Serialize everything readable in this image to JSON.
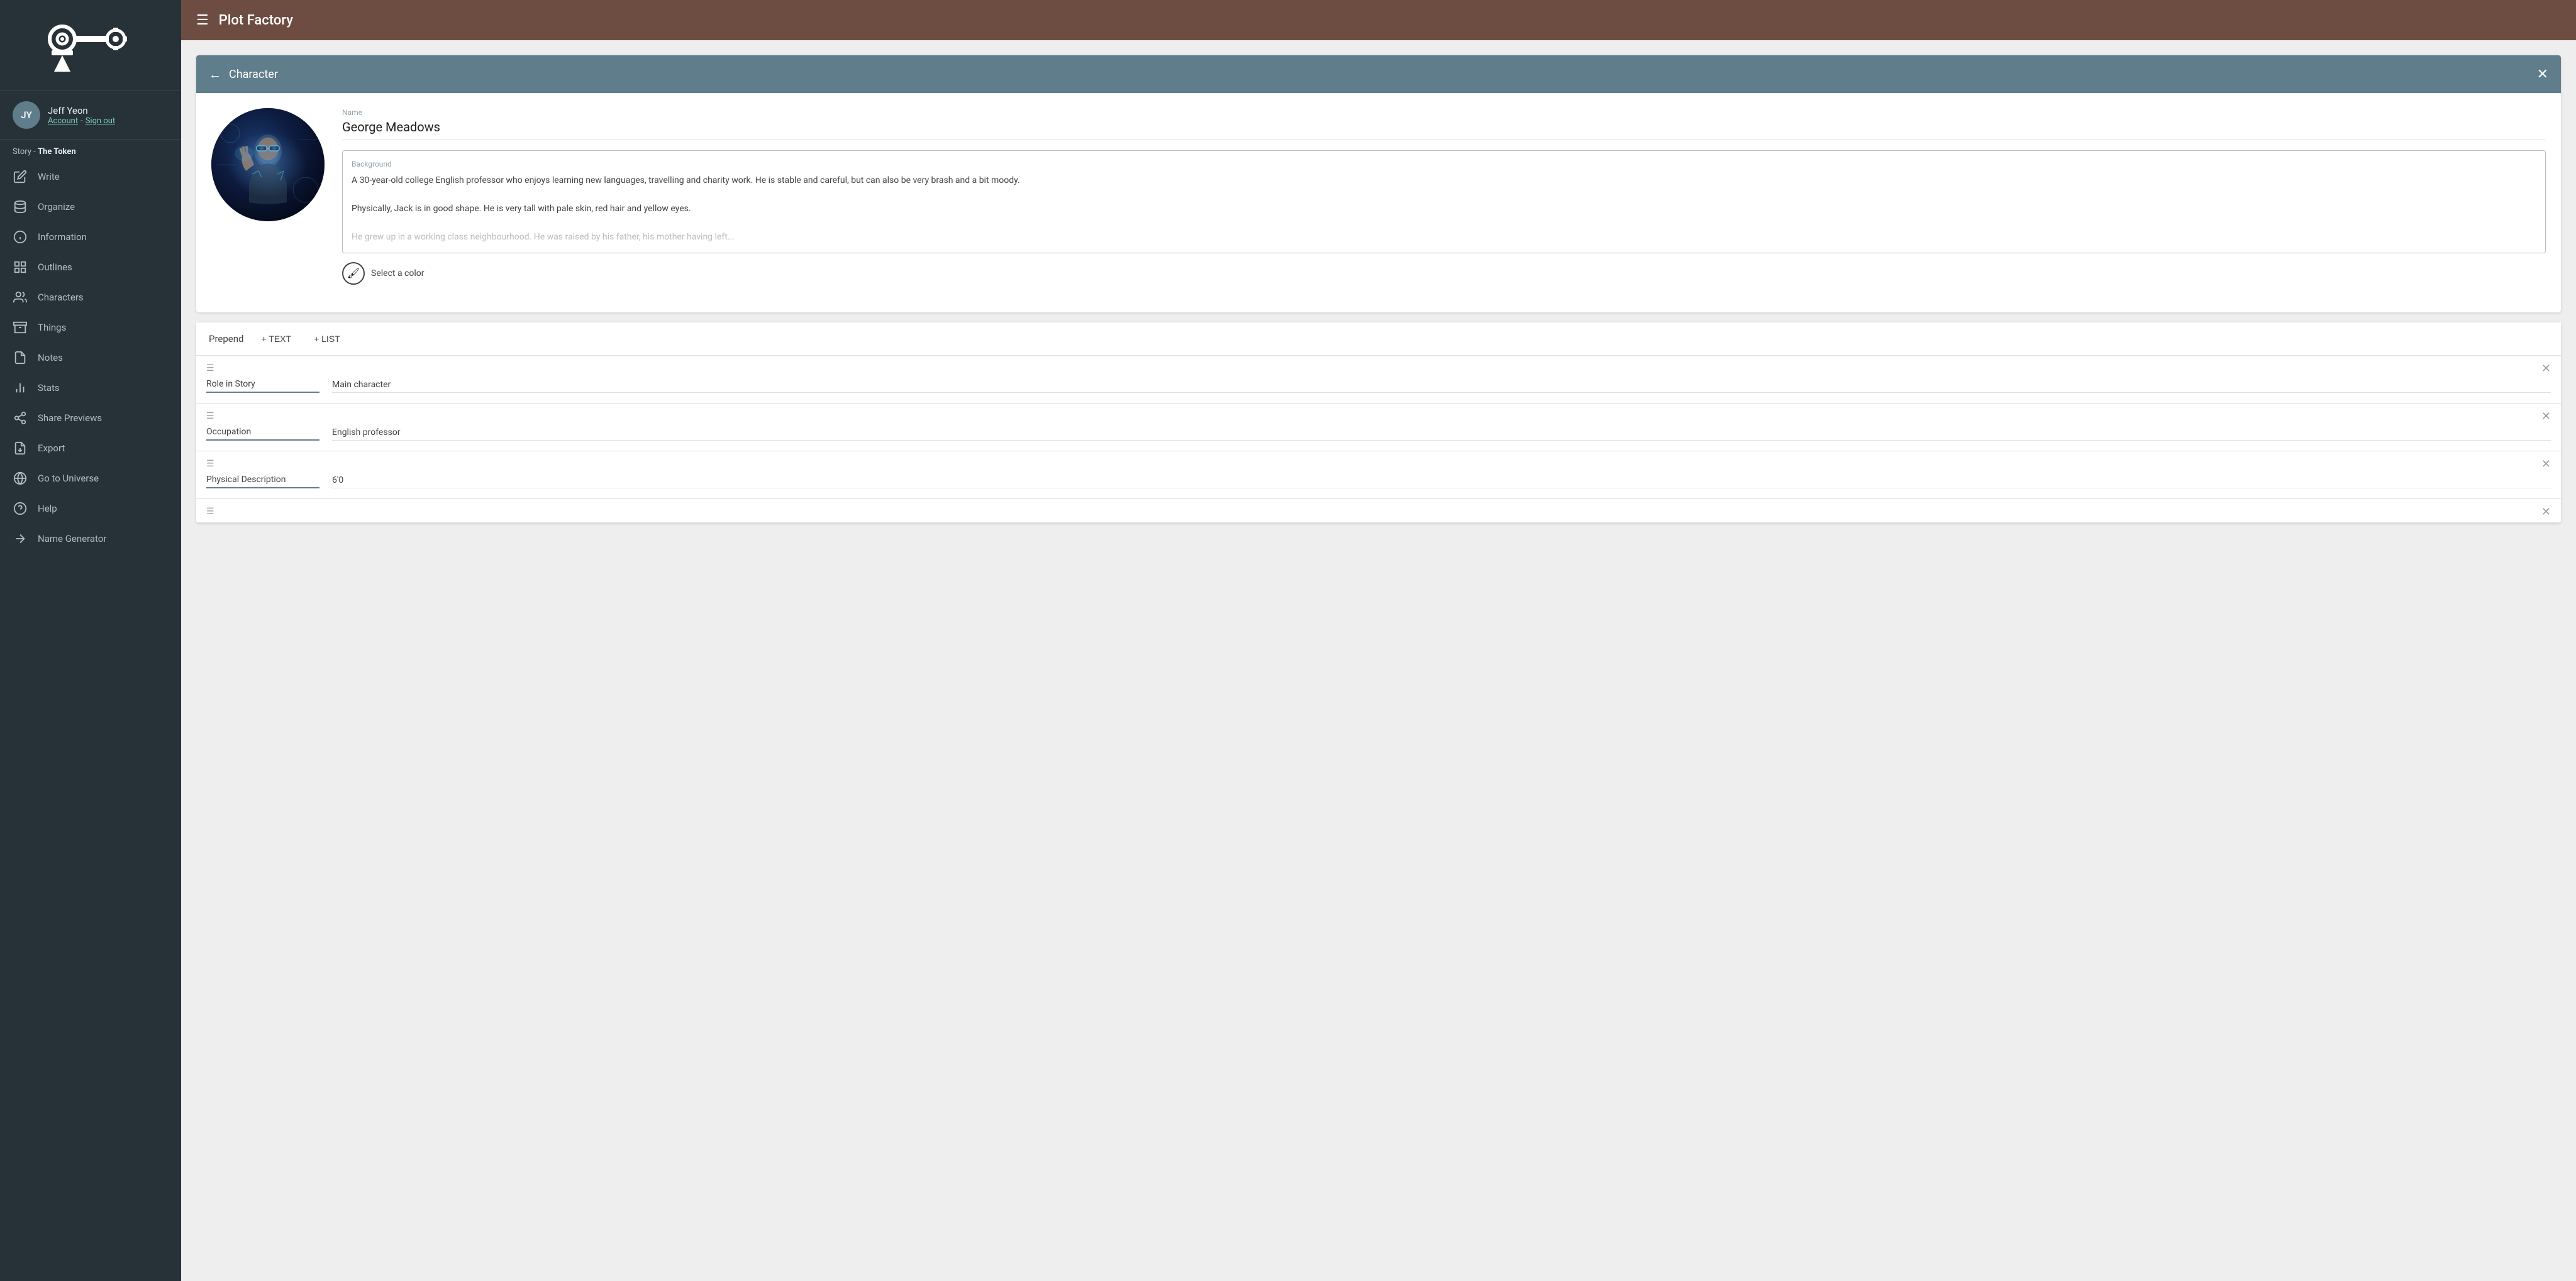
{
  "sidebar": {
    "logo_text": "Plot Factory",
    "user": {
      "initials": "JY",
      "name": "Jeff Yeon",
      "account_link": "Account",
      "separator": "-",
      "signout_link": "Sign out"
    },
    "story_label": "Story",
    "story_name": "The Token",
    "nav_items": [
      {
        "id": "write",
        "label": "Write",
        "icon": "pencil"
      },
      {
        "id": "organize",
        "label": "Organize",
        "icon": "layers"
      },
      {
        "id": "information",
        "label": "Information",
        "icon": "info"
      },
      {
        "id": "outlines",
        "label": "Outlines",
        "icon": "list"
      },
      {
        "id": "characters",
        "label": "Characters",
        "icon": "people"
      },
      {
        "id": "things",
        "label": "Things",
        "icon": "box"
      },
      {
        "id": "notes",
        "label": "Notes",
        "icon": "note"
      },
      {
        "id": "stats",
        "label": "Stats",
        "icon": "chart"
      },
      {
        "id": "share-previews",
        "label": "Share Previews",
        "icon": "share"
      },
      {
        "id": "export",
        "label": "Export",
        "icon": "export"
      },
      {
        "id": "go-to-universe",
        "label": "Go to Universe",
        "icon": "globe"
      },
      {
        "id": "help",
        "label": "Help",
        "icon": "help"
      },
      {
        "id": "name-generator",
        "label": "Name Generator",
        "icon": "magic"
      }
    ]
  },
  "topbar": {
    "title": "Plot Factory"
  },
  "character_card": {
    "header_title": "Character",
    "name_label": "Name",
    "name_value": "George Meadows",
    "background_label": "Background",
    "background_text": "A 30-year-old college English professor who enjoys learning new languages, travelling and charity work. He is stable and careful, but can also be very brash and a bit moody.\n\nPhysically, Jack is in good shape. He is very tall with pale skin, red hair and yellow eyes.\n\nHe grew up in a working class neighbourhood. He was raised by his father, his mother having left...",
    "color_select_label": "Select a color"
  },
  "sections": {
    "prepend_label": "Prepend",
    "add_text_label": "+ TEXT",
    "add_list_label": "+ LIST",
    "items": [
      {
        "key": "Role in Story",
        "value": "Main character"
      },
      {
        "key": "Occupation",
        "value": "English professor"
      },
      {
        "key": "Physical Description",
        "value": "6'0"
      },
      {
        "key": "",
        "value": ""
      }
    ]
  }
}
